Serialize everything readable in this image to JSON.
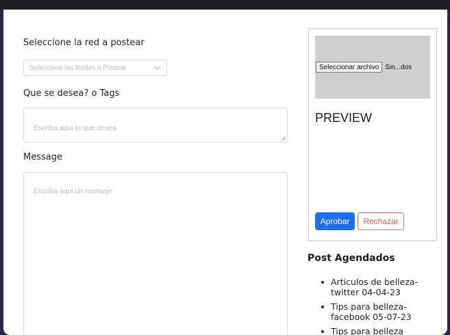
{
  "form": {
    "network_label": "Seleccione la red a postear",
    "network_placeholder": "Seleccione las Redes a Postear",
    "tags_label": "Que se desea? o Tags",
    "tags_placeholder": "Escriba aqui lo que desea",
    "message_label": "Message",
    "message_placeholder": "Escriba aqui un mensaje"
  },
  "preview": {
    "file_button": "Seleccionar archivo",
    "file_name": "Sin...dos",
    "title": "PREVIEW",
    "approve_label": "Aprobar",
    "reject_label": "Rechazar"
  },
  "scheduled": {
    "title": "Post Agendados",
    "items": [
      {
        "label": "Articulos de belleza-twitter 04-04-23"
      },
      {
        "label": "Tips para belleza-facebook 05-07-23"
      },
      {
        "label": "Tips para belleza"
      }
    ]
  },
  "colors": {
    "approve": "#1d6ff2",
    "reject": "#e05555",
    "backdrop": "#2b2548"
  }
}
